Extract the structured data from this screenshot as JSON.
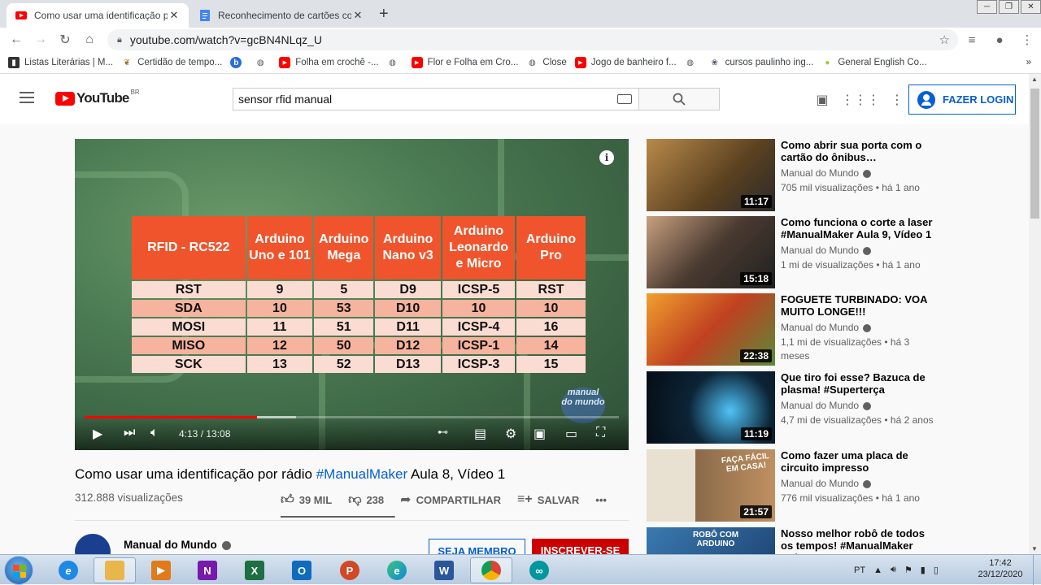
{
  "browser": {
    "tabs": [
      {
        "title": "Como usar uma identificação por rádio",
        "active": true,
        "favicon": "youtube-icon"
      },
      {
        "title": "Reconhecimento de cartões com",
        "active": false,
        "favicon": "docs-icon"
      }
    ],
    "new_tab": "+",
    "window_controls": [
      "─",
      "❐",
      "✕"
    ],
    "url": "youtube.com/watch?v=gcBN4NLqz_U",
    "bookmarks": [
      {
        "label": "Listas Literárias | M...",
        "icon": "book-icon"
      },
      {
        "label": "Certidão de tempo...",
        "icon": "leaf-icon"
      },
      {
        "label": "",
        "icon": "b-icon"
      },
      {
        "label": "",
        "icon": "globe-icon"
      },
      {
        "label": "Folha em crochê -...",
        "icon": "youtube-icon"
      },
      {
        "label": "",
        "icon": "globe-icon"
      },
      {
        "label": "Flor e Folha em Cro...",
        "icon": "youtube-icon"
      },
      {
        "label": "Close",
        "icon": "globe-icon"
      },
      {
        "label": "Jogo de banheiro f...",
        "icon": "youtube-icon"
      },
      {
        "label": "",
        "icon": "globe-icon"
      },
      {
        "label": "cursos paulinho ing...",
        "icon": "bird-icon"
      },
      {
        "label": "General English Co...",
        "icon": "bulb-icon"
      }
    ],
    "bookmarks_more": "»"
  },
  "youtube": {
    "logo_text": "YouTube",
    "region": "BR",
    "search_value": "sensor rfid manual",
    "login_label": "FAZER LOGIN"
  },
  "player": {
    "time": "4:13 / 13:08",
    "progress_fraction": 0.322,
    "buffer_fraction": 0.395,
    "watermark": "manual do mundo",
    "table": {
      "headers": [
        "RFID - RC522",
        "Arduino Uno e 101",
        "Arduino Mega",
        "Arduino Nano v3",
        "Arduino Leonardo e Micro",
        "Arduino Pro"
      ],
      "rows": [
        [
          "RST",
          "9",
          "5",
          "D9",
          "ICSP-5",
          "RST"
        ],
        [
          "SDA",
          "10",
          "53",
          "D10",
          "10",
          "10"
        ],
        [
          "MOSI",
          "11",
          "51",
          "D11",
          "ICSP-4",
          "16"
        ],
        [
          "MISO",
          "12",
          "50",
          "D12",
          "ICSP-1",
          "14"
        ],
        [
          "SCK",
          "13",
          "52",
          "D13",
          "ICSP-3",
          "15"
        ]
      ]
    }
  },
  "video": {
    "title_before": "Como usar uma identificação por rádio ",
    "title_tag": "#ManualMaker",
    "title_after": " Aula 8, Vídeo 1",
    "views": "312.888 visualizações",
    "likes": "39 MIL",
    "dislikes": "238",
    "like_fraction": 0.994,
    "share": "COMPARTILHAR",
    "save": "SALVAR",
    "more": "•••",
    "channel": "Manual do Mundo",
    "member_btn": "SEJA MEMBRO",
    "subscribe_btn": "INSCREVER-SE"
  },
  "recommendations": [
    {
      "title": "Como abrir sua porta com o cartão do ônibus…",
      "channel": "Manual do Mundo",
      "meta": "705 mil visualizações • há 1 ano",
      "duration": "11:17",
      "color": "#6a5a3a"
    },
    {
      "title": "Como funciona o corte a laser #ManualMaker Aula 9, Vídeo 1",
      "channel": "Manual do Mundo",
      "meta": "1 mi de visualizações • há 1 ano",
      "duration": "15:18",
      "color": "#3a3a3a"
    },
    {
      "title": "FOGUETE TURBINADO: VOA MUITO LONGE!!!",
      "channel": "Manual do Mundo",
      "meta": "1,1 mi de visualizações • há 3 meses",
      "duration": "22:38",
      "color": "#c0562a"
    },
    {
      "title": "Que tiro foi esse? Bazuca de plasma! #Superterça",
      "channel": "Manual do Mundo",
      "meta": "4,7 mi de visualizações • há 2 anos",
      "duration": "11:19",
      "color": "#0c2436"
    },
    {
      "title": "Como fazer uma placa de circuito impresso",
      "channel": "Manual do Mundo",
      "meta": "776 mil visualizações • há 1 ano",
      "duration": "21:57",
      "color": "#8a6a4a",
      "overlay": "FAÇA FÁCIL EM CASA!"
    },
    {
      "title": "Nosso melhor robô de todos os tempos! #ManualMaker Aula…",
      "channel": "",
      "meta": "",
      "duration": "",
      "color": "#2a5a8a",
      "overlay": "ROBÔ COM ARDUINO"
    }
  ],
  "taskbar": {
    "apps": [
      {
        "name": "ie-icon",
        "label": "e",
        "color": "#1e88e5"
      },
      {
        "name": "explorer-icon",
        "label": "",
        "color": "#e8b64a"
      },
      {
        "name": "media-icon",
        "label": "▶",
        "color": "#e07a1a"
      },
      {
        "name": "onenote-icon",
        "label": "N",
        "color": "#7719aa"
      },
      {
        "name": "excel-icon",
        "label": "X",
        "color": "#1d6f42"
      },
      {
        "name": "outlook-icon",
        "label": "O",
        "color": "#0f6cbd"
      },
      {
        "name": "powerpoint-icon",
        "label": "P",
        "color": "#d24726"
      },
      {
        "name": "edge-icon",
        "label": "e",
        "color": "#0b8ad8"
      },
      {
        "name": "word-icon",
        "label": "W",
        "color": "#2b579a"
      },
      {
        "name": "chrome-icon",
        "label": "",
        "color": "#db4437"
      },
      {
        "name": "arduino-icon",
        "label": "∞",
        "color": "#00979c"
      }
    ],
    "language": "PT",
    "time": "17:42",
    "date": "23/12/2020"
  }
}
